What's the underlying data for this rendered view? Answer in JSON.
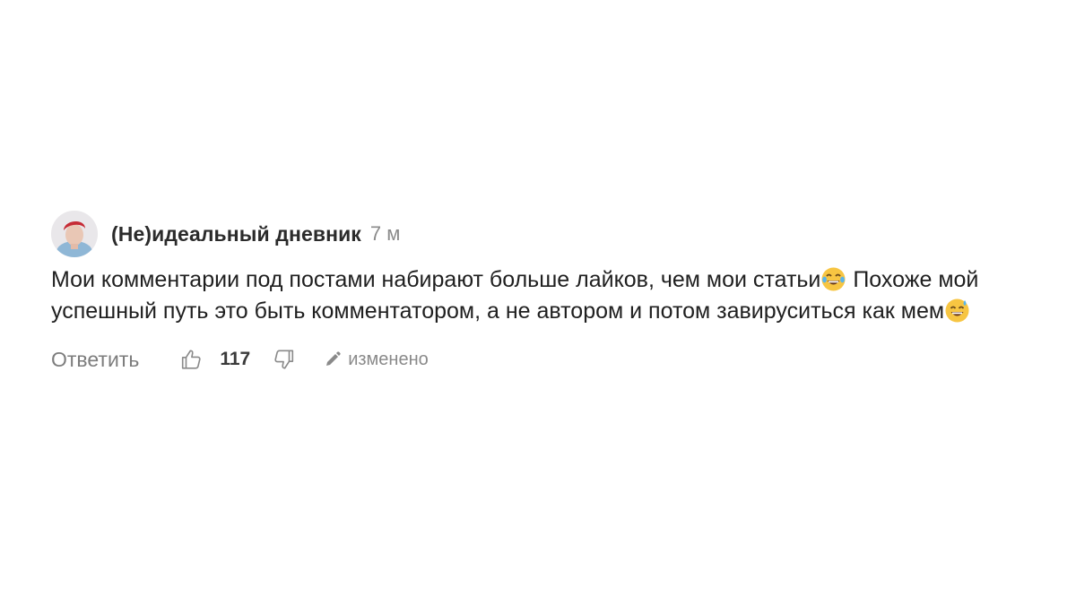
{
  "comment": {
    "author": "(Не)идеальный дневник",
    "time": "7 м",
    "text_part1": "Мои комментарии под постами набирают больше лайков, чем мои статьи",
    "text_part2": " Похоже мой успешный путь это быть комментатором, а не автором и потом завируситься как мем",
    "emoji_1": "face-with-tears-of-joy-icon",
    "emoji_2": "grinning-face-with-sweat-icon"
  },
  "actions": {
    "reply_label": "Ответить",
    "like_count": "117",
    "edited_label": "изменено",
    "icons": {
      "like": "thumbs-up-icon",
      "dislike": "thumbs-down-icon",
      "edited": "pencil-icon"
    }
  },
  "colors": {
    "text": "#1f1f1f",
    "muted": "#8a8a8a",
    "background": "#ffffff",
    "emoji_yellow": "#f7c542"
  }
}
